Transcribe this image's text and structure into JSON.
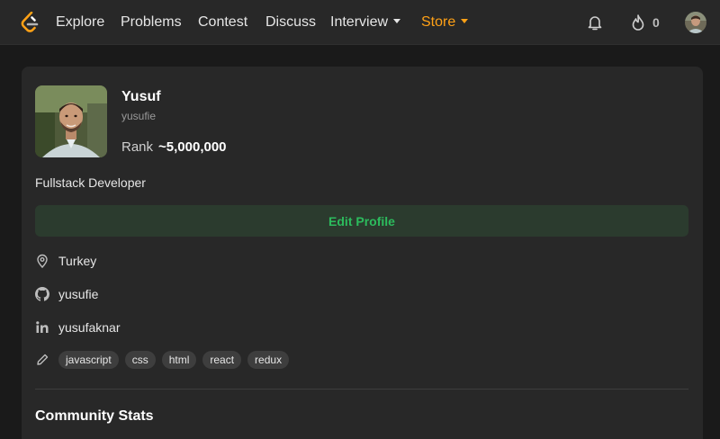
{
  "nav": {
    "links": [
      {
        "label": "Explore"
      },
      {
        "label": "Problems"
      },
      {
        "label": "Contest"
      },
      {
        "label": "Discuss"
      },
      {
        "label": "Interview"
      },
      {
        "label": "Store"
      }
    ],
    "streak_count": "0",
    "accent_color": "#ffa116",
    "icons": [
      "leetcode-logo",
      "bell-icon",
      "fire-icon",
      "avatar"
    ]
  },
  "profile": {
    "display_name": "Yusuf",
    "username": "yusufie",
    "rank_label": "Rank",
    "rank_value": "~5,000,000",
    "bio": "Fullstack Developer",
    "edit_button": "Edit Profile",
    "location": "Turkey",
    "github": "yusufie",
    "linkedin": "yusufaknar",
    "skills": [
      "javascript",
      "css",
      "html",
      "react",
      "redux"
    ],
    "accent_green": "#2cbb5d"
  },
  "sections": {
    "community_stats": "Community Stats"
  }
}
